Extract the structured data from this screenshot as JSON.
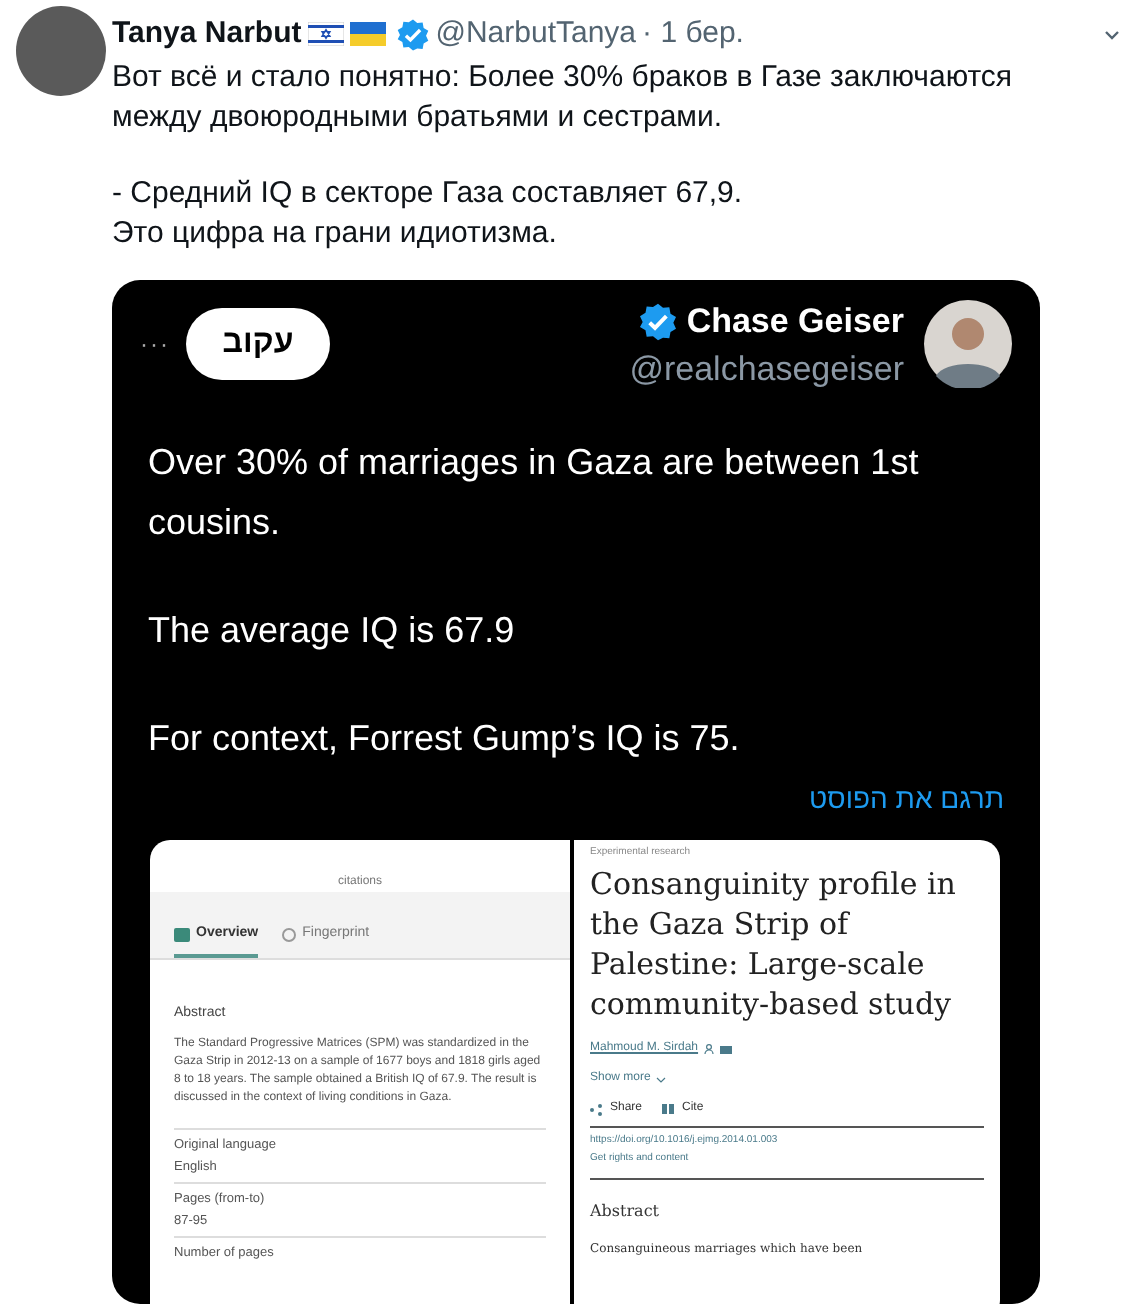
{
  "tweet": {
    "author": {
      "name": "Tanya Narbut",
      "handle": "@NarbutTanya",
      "time": "· 1 бер."
    },
    "paragraphs": [
      "Вот всё и стало понятно: Более 30% браков в Газе заключаются между двоюродными братьями и сестрами.",
      "- Средний IQ в секторе Газа составляет 67,9.\nЭто цифра на грани идиотизма."
    ]
  },
  "embedded_post": {
    "more": "···",
    "follow_button": "עקוב",
    "name": "Chase Geiser",
    "handle": "@realchasegeiser",
    "paragraphs": [
      "Over 30% of marriages in Gaza are between 1st cousins.",
      "The average IQ is 67.9",
      "For context, Forrest Gump’s IQ is 75."
    ],
    "translate_link": "תרגם את הפוסט"
  },
  "left_page": {
    "stat_label": "citations",
    "tabs": [
      {
        "label": "Overview",
        "selected": true
      },
      {
        "label": "Fingerprint",
        "selected": false
      }
    ],
    "abstract_heading": "Abstract",
    "abstract": "The Standard Progressive Matrices (SPM) was standardized in the Gaza Strip in 2012-13 on a sample of 1677 boys and 1818 girls aged 8 to 18 years. The sample obtained a British IQ of 67.9. The result is discussed in the context of living conditions in Gaza.",
    "fields": [
      {
        "label": "Original language",
        "value": "English"
      },
      {
        "label": "Pages (from-to)",
        "value": "87-95"
      },
      {
        "label": "Number of pages"
      }
    ]
  },
  "right_page": {
    "category": "Experimental research",
    "title": "Consanguinity profile in the Gaza Strip of Palestine: Large-scale community-based study",
    "author": "Mahmoud M. Sirdah",
    "show_more": "Show more",
    "share": "Share",
    "cite": "Cite",
    "doi": "https://doi.org/10.1016/j.ejmg.2014.01.003",
    "rights": "Get rights and content",
    "abstract_heading": "Abstract",
    "abstract_start": "Consanguineous marriages which have been"
  }
}
